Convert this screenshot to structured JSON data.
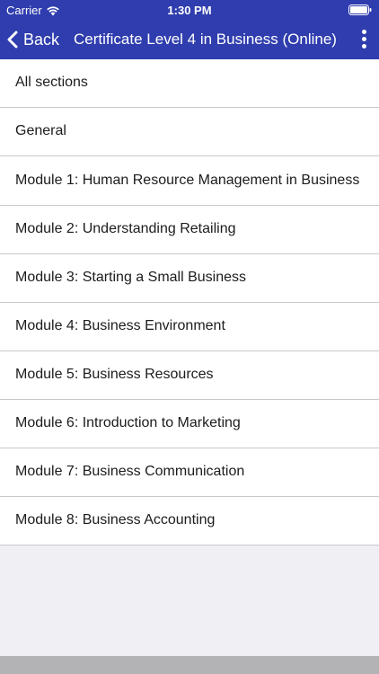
{
  "status_bar": {
    "carrier": "Carrier",
    "time": "1:30 PM",
    "wifi_icon": "wifi-icon",
    "battery_icon": "battery-icon"
  },
  "nav": {
    "back_label": "Back",
    "title": "Certificate Level 4 in Business (Online)",
    "menu_icon": "more-vertical-icon"
  },
  "sections": [
    "All sections",
    "General",
    "Module 1: Human Resource Management in Business",
    "Module 2: Understanding Retailing",
    "Module 3: Starting a Small Business",
    "Module 4: Business Environment",
    "Module 5: Business Resources",
    "Module 6: Introduction to Marketing",
    "Module 7: Business Communication",
    "Module 8: Business Accounting"
  ],
  "colors": {
    "header": "#2f3dae",
    "background": "#efeff4"
  }
}
